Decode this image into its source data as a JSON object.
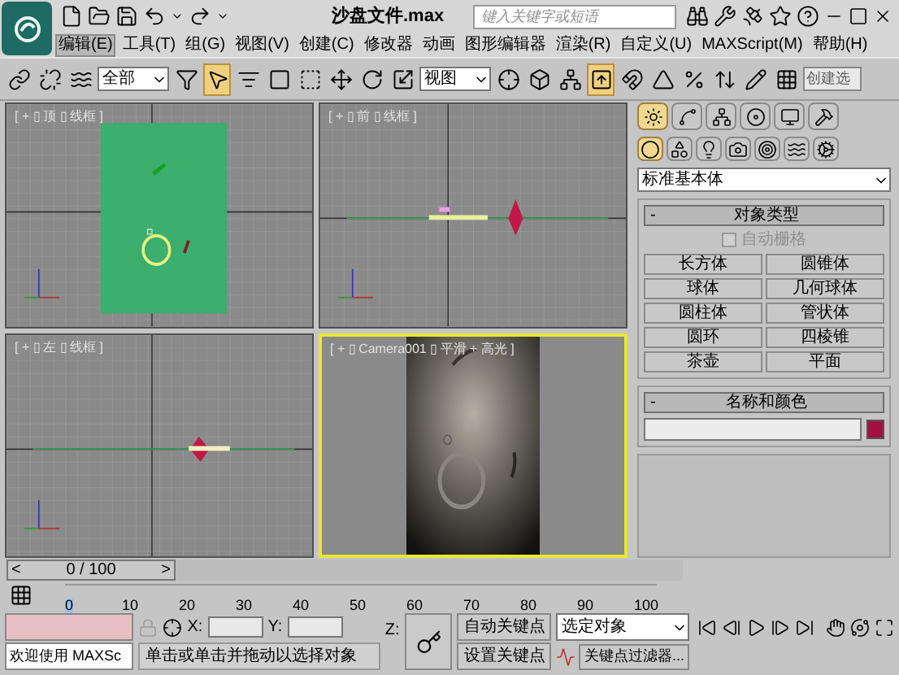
{
  "title_bar": {
    "file_name": "沙盘文件.max",
    "search_placeholder": "键入关键字或短语"
  },
  "menu": [
    {
      "label": "编辑(E)",
      "selected": true
    },
    {
      "label": "工具(T)",
      "selected": false
    },
    {
      "label": "组(G)",
      "selected": false
    },
    {
      "label": "视图(V)",
      "selected": false
    },
    {
      "label": "创建(C)",
      "selected": false
    },
    {
      "label": "修改器",
      "selected": false
    },
    {
      "label": "动画",
      "selected": false
    },
    {
      "label": "图形编辑器",
      "selected": false
    },
    {
      "label": "渲染(R)",
      "selected": false
    },
    {
      "label": "自定义(U)",
      "selected": false
    },
    {
      "label": "MAXScript(M)",
      "selected": false
    },
    {
      "label": "帮助(H)",
      "selected": false
    }
  ],
  "toolbar": {
    "filter": "全部",
    "coord_system": "视图",
    "selection_set": "创建选",
    "tools": [
      {
        "kind": "link",
        "active": false
      },
      {
        "kind": "unlink",
        "active": false
      },
      {
        "kind": "bind",
        "active": false
      },
      {
        "kind": "filter",
        "active": false
      },
      {
        "kind": "select",
        "active": true
      },
      {
        "kind": "select_by_name",
        "active": false
      },
      {
        "kind": "region",
        "active": false
      },
      {
        "kind": "window",
        "active": false
      },
      {
        "kind": "move",
        "active": false
      },
      {
        "kind": "rotate",
        "active": false
      },
      {
        "kind": "scale",
        "active": false
      },
      {
        "kind": "coord",
        "active": false
      },
      {
        "kind": "pivot",
        "active": false
      },
      {
        "kind": "manipulate",
        "active": false
      },
      {
        "kind": "keyboard",
        "active": true
      },
      {
        "kind": "snap",
        "active": false
      },
      {
        "kind": "angle_snap",
        "active": false
      },
      {
        "kind": "percent_snap",
        "active": false
      },
      {
        "kind": "spinner_snap",
        "active": false
      },
      {
        "kind": "edit_named",
        "active": false
      },
      {
        "kind": "named_set",
        "active": false
      }
    ]
  },
  "viewports": [
    {
      "label": "[ + ▯ 顶 ▯ 线框 ]",
      "kind": "top",
      "active": false
    },
    {
      "label": "[ + ▯ 前 ▯ 线框 ]",
      "kind": "front",
      "active": false
    },
    {
      "label": "[ + ▯ 左 ▯ 线框 ]",
      "kind": "left",
      "active": false
    },
    {
      "label": "[ + ▯ Camera001 ▯ 平滑 + 高光 ]",
      "kind": "camera",
      "active": true
    }
  ],
  "command_panel": {
    "tabs": [
      {
        "kind": "create",
        "selected": true
      },
      {
        "kind": "modify",
        "selected": false
      },
      {
        "kind": "hierarchy",
        "selected": false
      },
      {
        "kind": "motion",
        "selected": false
      },
      {
        "kind": "display",
        "selected": false
      },
      {
        "kind": "utilities",
        "selected": false
      }
    ],
    "categories": [
      {
        "kind": "geometry",
        "selected": true
      },
      {
        "kind": "shapes",
        "selected": false
      },
      {
        "kind": "lights",
        "selected": false
      },
      {
        "kind": "cameras",
        "selected": false
      },
      {
        "kind": "helpers",
        "selected": false
      },
      {
        "kind": "spacewarps",
        "selected": false
      },
      {
        "kind": "systems",
        "selected": false
      }
    ],
    "type_list": "标准基本体",
    "object_type": {
      "collapse_mark": "-",
      "title": "对象类型",
      "auto_grid": {
        "label": "自动栅格",
        "checked": false,
        "disabled": true
      },
      "buttons": [
        "长方体",
        "圆锥体",
        "球体",
        "几何球体",
        "圆柱体",
        "管状体",
        "圆环",
        "四棱锥",
        "茶壶",
        "平面"
      ]
    },
    "name_and_color": {
      "collapse_mark": "-",
      "title": "名称和颜色",
      "color": "#a01040"
    }
  },
  "time_slider": {
    "prev": "<",
    "position": "0 / 100",
    "next": ">",
    "level": 0
  },
  "ruler": {
    "ticks": [
      "0",
      "10",
      "20",
      "30",
      "40",
      "50",
      "60",
      "70",
      "80",
      "90",
      "100"
    ]
  },
  "status": {
    "listener_text": "欢迎使用 MAXSc",
    "prompt": "单击或单击并拖动以选择对象",
    "x_label": "X:",
    "y_label": "Y:",
    "z_label": "Z:",
    "auto_key": "自动关键点",
    "set_key": "设置关键点",
    "selection": "选定对象",
    "key_filters": "关键点过滤器..."
  }
}
